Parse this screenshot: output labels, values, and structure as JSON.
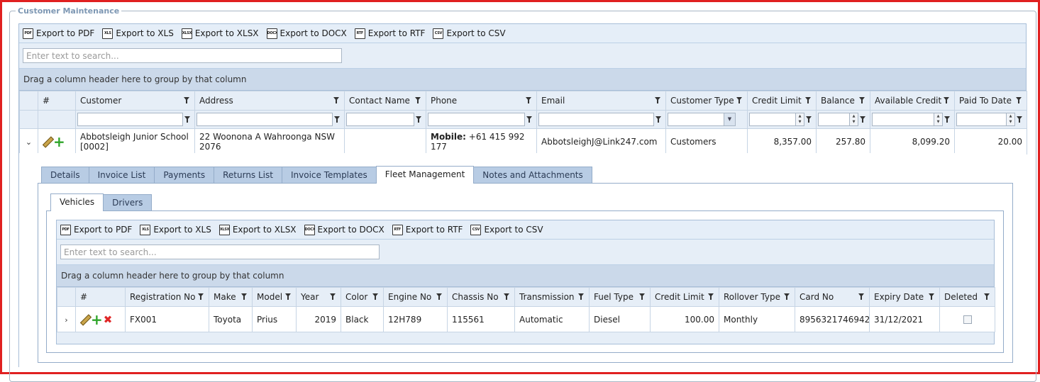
{
  "section_title": "Customer Maintenance",
  "export_buttons": [
    {
      "icon": "pdf-file-icon",
      "icon_text": "PDF",
      "label": "Export to PDF"
    },
    {
      "icon": "xls-file-icon",
      "icon_text": "XLS",
      "label": "Export to XLS"
    },
    {
      "icon": "xlsx-file-icon",
      "icon_text": "XLSX",
      "label": "Export to XLSX"
    },
    {
      "icon": "docx-file-icon",
      "icon_text": "DOCX",
      "label": "Export to DOCX"
    },
    {
      "icon": "rtf-file-icon",
      "icon_text": "RTF",
      "label": "Export to RTF"
    },
    {
      "icon": "csv-file-icon",
      "icon_text": "CSV",
      "label": "Export to CSV"
    }
  ],
  "customers": {
    "search_placeholder": "Enter text to search...",
    "group_panel_text": "Drag a column header here to group by that column",
    "columns": [
      "",
      "#",
      "Customer",
      "Address",
      "Contact Name",
      "Phone",
      "Email",
      "Customer Type",
      "Credit Limit",
      "Balance",
      "Available Credit",
      "Paid To Date"
    ],
    "row": {
      "customer": "Abbotsleigh Junior School [0002]",
      "address": "22 Woonona A Wahroonga NSW 2076",
      "contact_name": "",
      "phone_label": "Mobile:",
      "phone_value": "+61 415 992 177",
      "email": "AbbotsleighJ@Link247.com",
      "customer_type": "Customers",
      "credit_limit": "8,357.00",
      "balance": "257.80",
      "available_credit": "8,099.20",
      "paid_to_date": "20.00"
    }
  },
  "detail_tabs": [
    "Details",
    "Invoice List",
    "Payments",
    "Returns List",
    "Invoice Templates",
    "Fleet Management",
    "Notes and Attachments"
  ],
  "fleet_tabs": [
    "Vehicles",
    "Drivers"
  ],
  "vehicles": {
    "search_placeholder": "Enter text to search...",
    "group_panel_text": "Drag a column header here to group by that column",
    "columns": [
      "",
      "#",
      "Registration No",
      "Make",
      "Model",
      "Year",
      "Color",
      "Engine No",
      "Chassis No",
      "Transmission",
      "Fuel Type",
      "Credit Limit",
      "Rollover Type",
      "Card No",
      "Expiry Date",
      "Deleted"
    ],
    "row": {
      "registration_no": "FX001",
      "make": "Toyota",
      "model": "Prius",
      "year": "2019",
      "color": "Black",
      "engine_no": "12H789",
      "chassis_no": "115561",
      "transmission": "Automatic",
      "fuel_type": "Diesel",
      "credit_limit": "100.00",
      "rollover_type": "Monthly",
      "card_no": "8956321746942",
      "expiry_date": "31/12/2021",
      "deleted": false
    }
  }
}
